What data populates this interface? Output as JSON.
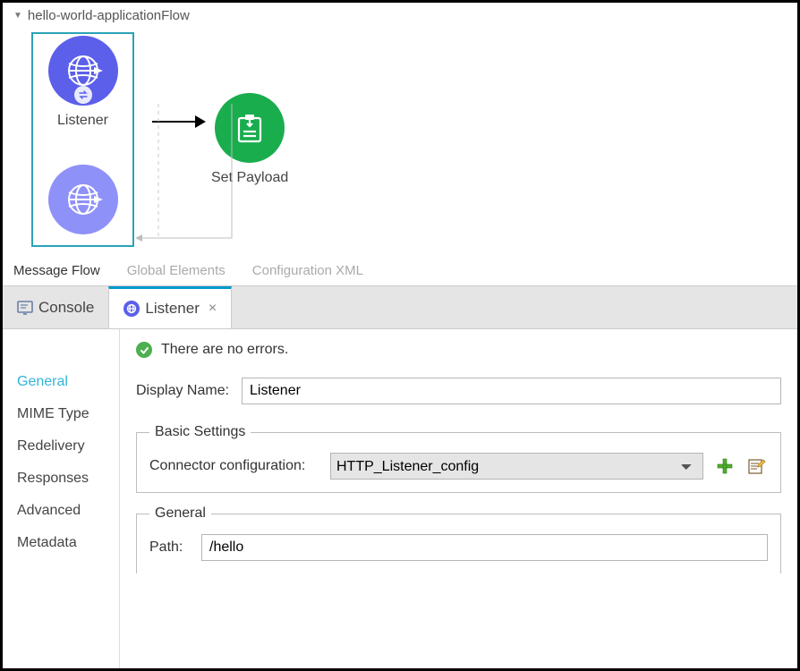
{
  "flow": {
    "title": "hello-world-applicationFlow",
    "nodes": {
      "listener_label": "Listener",
      "set_payload_label": "Set Payload"
    }
  },
  "editor_tabs": {
    "message_flow": "Message Flow",
    "global_elements": "Global Elements",
    "config_xml": "Configuration XML"
  },
  "view_tabs": {
    "console": "Console",
    "listener": "Listener"
  },
  "side_nav": {
    "items": [
      "General",
      "MIME Type",
      "Redelivery",
      "Responses",
      "Advanced",
      "Metadata"
    ]
  },
  "status": {
    "no_errors": "There are no errors."
  },
  "form": {
    "display_name_label": "Display Name:",
    "display_name_value": "Listener",
    "basic_settings_legend": "Basic Settings",
    "connector_label": "Connector configuration:",
    "connector_value": "HTTP_Listener_config",
    "general_legend": "General",
    "path_label": "Path:",
    "path_value": "/hello"
  },
  "icons": {
    "add": "add-icon",
    "edit": "edit-icon"
  }
}
